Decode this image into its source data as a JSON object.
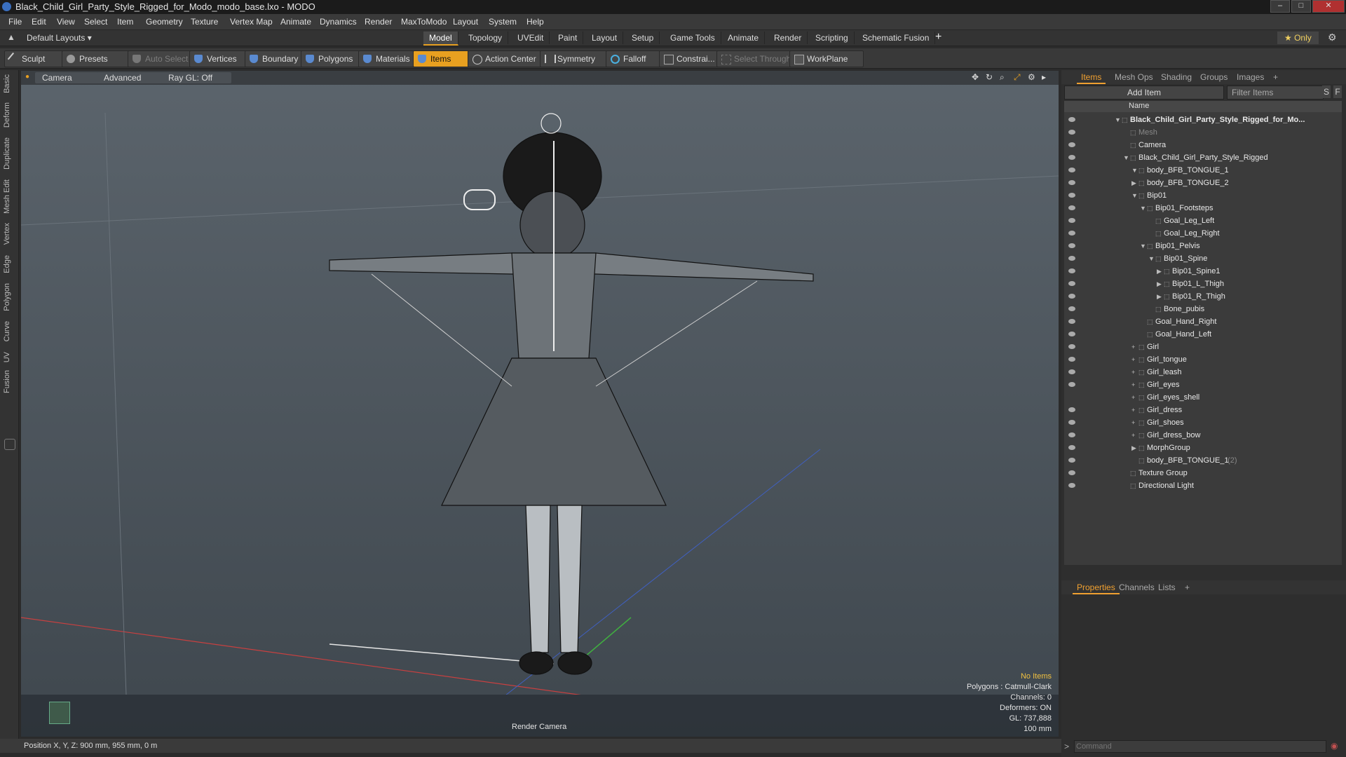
{
  "window": {
    "title": "Black_Child_Girl_Party_Style_Rigged_for_Modo_modo_base.lxo - MODO",
    "minimize": "–",
    "maximize": "□",
    "close": "✕"
  },
  "menu": [
    "File",
    "Edit",
    "View",
    "Select",
    "Item",
    "Geometry",
    "Texture",
    "Vertex Map",
    "Animate",
    "Dynamics",
    "Render",
    "MaxToModo",
    "Layout",
    "System",
    "Help"
  ],
  "layout_selector": "Default Layouts ▾",
  "layout_tabs": [
    "Model",
    "Topology",
    "UVEdit",
    "Paint",
    "Layout",
    "Setup",
    "Game Tools",
    "Animate",
    "Render",
    "Scripting",
    "Schematic Fusion"
  ],
  "layout_add": "+",
  "only_label": "★ Only",
  "toolbar": {
    "sculpt": "Sculpt",
    "presets": "Presets",
    "auto_select": "Auto Select",
    "vertices": "Vertices",
    "boundary": "Boundary",
    "polygons": "Polygons",
    "materials": "Materials",
    "items": "Items",
    "action_center": "Action Center",
    "symmetry": "Symmetry",
    "falloff": "Falloff",
    "constraints": "Constrai...",
    "select_through": "Select Through",
    "workplane": "WorkPlane"
  },
  "left_tabs": [
    "Basic",
    "Deform",
    "Duplicate",
    "Mesh Edit",
    "Vertex",
    "Edge",
    "Polygon",
    "Curve",
    "UV",
    "Fusion"
  ],
  "viewport": {
    "camera": "Camera",
    "advanced": "Advanced",
    "raygl": "Ray GL: Off",
    "render_camera": "Render Camera",
    "info": [
      "No Items",
      "Polygons : Catmull-Clark",
      "Channels: 0",
      "Deformers: ON",
      "GL: 737,888",
      "100 mm"
    ]
  },
  "right_tabs": [
    "Items",
    "Mesh Ops",
    "Shading",
    "Groups",
    "Images",
    "+"
  ],
  "add_item": "Add Item",
  "filter_items": "Filter Items",
  "filter_s": "S",
  "filter_f": "F",
  "list_header": "Name",
  "tree": [
    {
      "label": "Black_Child_Girl_Party_Style_Rigged_for_Mo...",
      "depth": 0,
      "tw": "▼",
      "bold": true,
      "eye": true
    },
    {
      "label": "Mesh",
      "depth": 1,
      "tw": "",
      "dim": true,
      "eye": true
    },
    {
      "label": "Camera",
      "depth": 1,
      "tw": "",
      "eye": true
    },
    {
      "label": "Black_Child_Girl_Party_Style_Rigged",
      "depth": 1,
      "tw": "▼",
      "eye": true
    },
    {
      "label": "body_BFB_TONGUE_1",
      "depth": 2,
      "tw": "▼",
      "eye": true
    },
    {
      "label": "body_BFB_TONGUE_2",
      "depth": 2,
      "tw": "▶",
      "eye": true
    },
    {
      "label": "Bip01",
      "depth": 2,
      "tw": "▼",
      "eye": true
    },
    {
      "label": "Bip01_Footsteps",
      "depth": 3,
      "tw": "▼",
      "eye": true
    },
    {
      "label": "Goal_Leg_Left",
      "depth": 4,
      "tw": "",
      "eye": true
    },
    {
      "label": "Goal_Leg_Right",
      "depth": 4,
      "tw": "",
      "eye": true
    },
    {
      "label": "Bip01_Pelvis",
      "depth": 3,
      "tw": "▼",
      "eye": true
    },
    {
      "label": "Bip01_Spine",
      "depth": 4,
      "tw": "▼",
      "eye": true
    },
    {
      "label": "Bip01_Spine1",
      "depth": 5,
      "tw": "▶",
      "eye": true
    },
    {
      "label": "Bip01_L_Thigh",
      "depth": 5,
      "tw": "▶",
      "eye": true
    },
    {
      "label": "Bip01_R_Thigh",
      "depth": 5,
      "tw": "▶",
      "eye": true
    },
    {
      "label": "Bone_pubis",
      "depth": 4,
      "tw": "",
      "eye": true
    },
    {
      "label": "Goal_Hand_Right",
      "depth": 3,
      "tw": "",
      "eye": true
    },
    {
      "label": "Goal_Hand_Left",
      "depth": 3,
      "tw": "",
      "eye": true
    },
    {
      "label": "Girl",
      "depth": 2,
      "tw": "+",
      "eye": true
    },
    {
      "label": "Girl_tongue",
      "depth": 2,
      "tw": "+",
      "eye": true
    },
    {
      "label": "Girl_leash",
      "depth": 2,
      "tw": "+",
      "eye": true
    },
    {
      "label": "Girl_eyes",
      "depth": 2,
      "tw": "+",
      "eye": true
    },
    {
      "label": "Girl_eyes_shell",
      "depth": 2,
      "tw": "+",
      "eye": false
    },
    {
      "label": "Girl_dress",
      "depth": 2,
      "tw": "+",
      "eye": true
    },
    {
      "label": "Girl_shoes",
      "depth": 2,
      "tw": "+",
      "eye": true
    },
    {
      "label": "Girl_dress_bow",
      "depth": 2,
      "tw": "+",
      "eye": true
    },
    {
      "label": "MorphGroup",
      "depth": 2,
      "tw": "▶",
      "eye": true
    },
    {
      "label": "body_BFB_TONGUE_1",
      "suffix": "(2)",
      "depth": 2,
      "tw": "",
      "eye": true
    },
    {
      "label": "Texture Group",
      "depth": 1,
      "tw": "",
      "eye": true
    },
    {
      "label": "Directional Light",
      "depth": 1,
      "tw": "",
      "eye": true
    }
  ],
  "bottom_tabs": [
    "Properties",
    "Channels",
    "Lists",
    "+"
  ],
  "status_position": "Position X, Y, Z:   900 mm, 955 mm, 0 m",
  "command_placeholder": "Command",
  "colors": {
    "accent": "#e8a020",
    "viewport_top": "#5b646c",
    "viewport_bottom": "#3f474e"
  }
}
